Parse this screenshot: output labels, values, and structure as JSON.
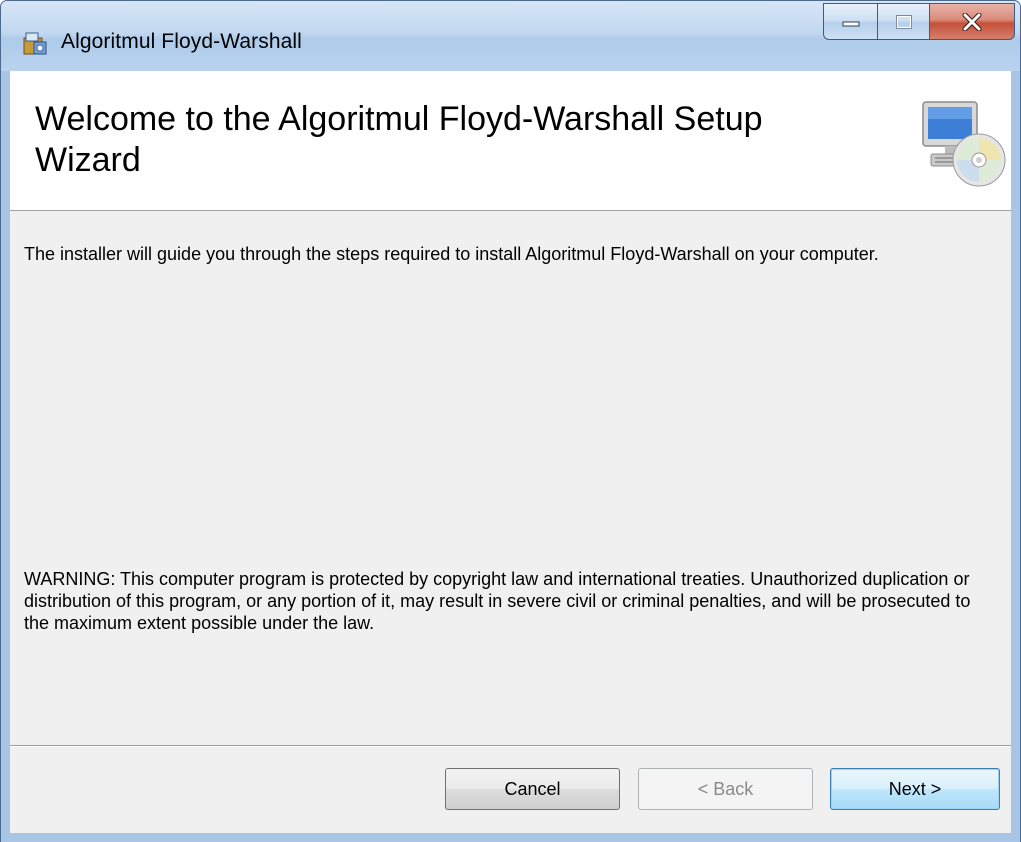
{
  "window": {
    "title": "Algoritmul Floyd-Warshall",
    "accent_color": "#a9c5e6",
    "close_color": "#c6503a"
  },
  "header": {
    "title": "Welcome to the Algoritmul Floyd-Warshall Setup Wizard",
    "icon": "computer-cd-icon"
  },
  "body": {
    "intro": "The installer will guide you through the steps required to install Algoritmul Floyd-Warshall on your computer.",
    "warning": "WARNING: This computer program is protected by copyright law and international treaties. Unauthorized duplication or distribution of this program, or any portion of it, may result in severe civil or criminal penalties, and will be prosecuted to the maximum extent possible under the law."
  },
  "buttons": {
    "cancel": "Cancel",
    "back": "< Back",
    "next": "Next >"
  },
  "caption_buttons": {
    "minimize": "minimize-icon",
    "maximize": "maximize-icon",
    "close": "close-icon"
  }
}
